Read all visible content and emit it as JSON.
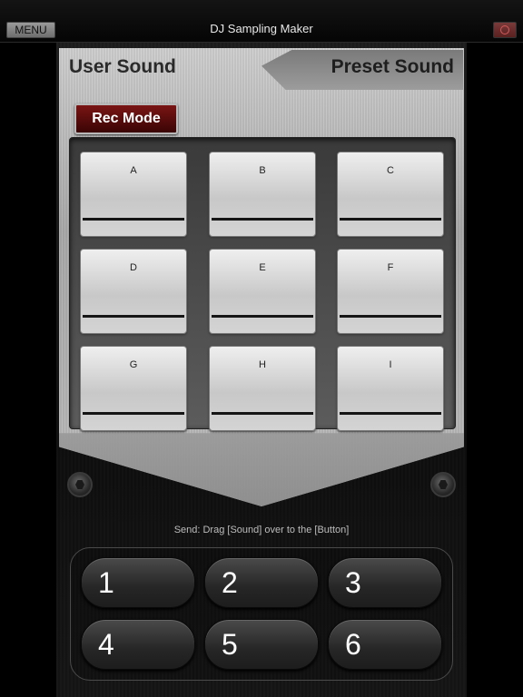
{
  "topbar": {
    "menu_label": "MENU",
    "title": "DJ Sampling Maker",
    "right_icon": "record-icon",
    "right_icon_color": "#d65a5a"
  },
  "tabs": {
    "user_sound": "User Sound",
    "preset_sound": "Preset Sound"
  },
  "rec_mode_label": "Rec Mode",
  "pads": [
    {
      "label": "A"
    },
    {
      "label": "B"
    },
    {
      "label": "C"
    },
    {
      "label": "D"
    },
    {
      "label": "E"
    },
    {
      "label": "F"
    },
    {
      "label": "G"
    },
    {
      "label": "H"
    },
    {
      "label": "I"
    }
  ],
  "send_instruction": "Send: Drag [Sound] over to the [Button]",
  "number_buttons": [
    "1",
    "2",
    "3",
    "4",
    "5",
    "6"
  ],
  "colors": {
    "rec_button": "#5a0a0a",
    "panel_metal": "#bdbdbd",
    "background": "#000000"
  }
}
